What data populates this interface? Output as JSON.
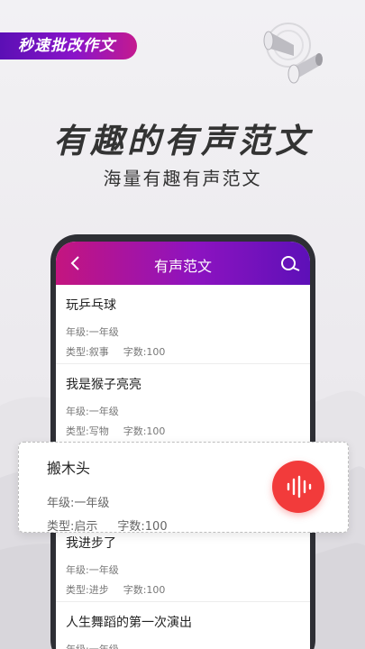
{
  "tag_label": "秒速批改作文",
  "headline": "有趣的有声范文",
  "subline": "海量有趣有声范文",
  "appbar": {
    "title": "有声范文"
  },
  "items": [
    {
      "title": "玩乒乓球",
      "grade": "年级:一年级",
      "type": "类型:叙事",
      "words": "字数:100"
    },
    {
      "title": "我是猴子亮亮",
      "grade": "年级:一年级",
      "type": "类型:写物",
      "words": "字数:100"
    },
    {
      "title": "",
      "grade": "",
      "type": "",
      "words": ""
    },
    {
      "title": "我进步了",
      "grade": "年级:一年级",
      "type": "类型:进步",
      "words": "字数:100"
    },
    {
      "title": "人生舞蹈的第一次演出",
      "grade": "年级:一年级",
      "type": "",
      "words": ""
    }
  ],
  "highlight": {
    "title": "搬木头",
    "grade": "年级:一年级",
    "type": "类型:启示",
    "words": "字数:100"
  },
  "colors": {
    "accent_purple": "#8d13c0",
    "accent_magenta": "#c4157f",
    "audio_red": "#f23b3b"
  },
  "icons": {
    "back": "chevron-left-icon",
    "search": "search-icon",
    "audio": "audio-wave-icon",
    "speaker": "megaphone-icon"
  }
}
